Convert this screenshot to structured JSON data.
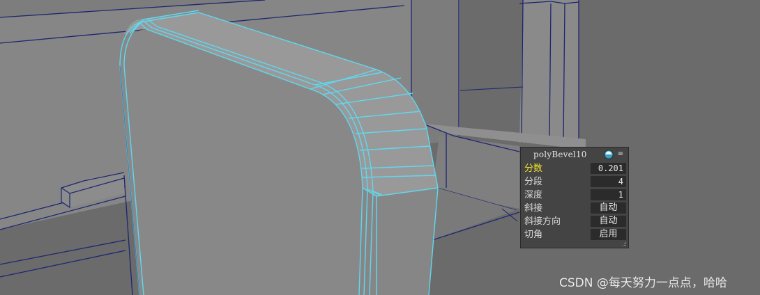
{
  "panel": {
    "title": "polyBevel10",
    "menu_glyph": "≡",
    "icons": {
      "orb": "sphere-orb-icon",
      "menu": "menu-lines-icon",
      "grip": "resize-grip-icon"
    },
    "attributes": [
      {
        "label": "分数",
        "value": "0.201",
        "highlighted": true
      },
      {
        "label": "分段",
        "value": "4"
      },
      {
        "label": "深度",
        "value": "1"
      },
      {
        "label": "斜接",
        "value": "自动"
      },
      {
        "label": "斜接方向",
        "value": "自动"
      },
      {
        "label": "切角",
        "value": "启用"
      }
    ]
  },
  "watermark": "CSDN @每天努力一点点，哈哈",
  "colors": {
    "viewport_bg": "#6e6e6e",
    "surface": "#8a8a8a",
    "wire": "#1c2570",
    "selected_wire": "#5fd8f0",
    "highlight_label": "#f2e22c",
    "panel_bg": "#444444",
    "field_bg": "#2b2b2b"
  }
}
